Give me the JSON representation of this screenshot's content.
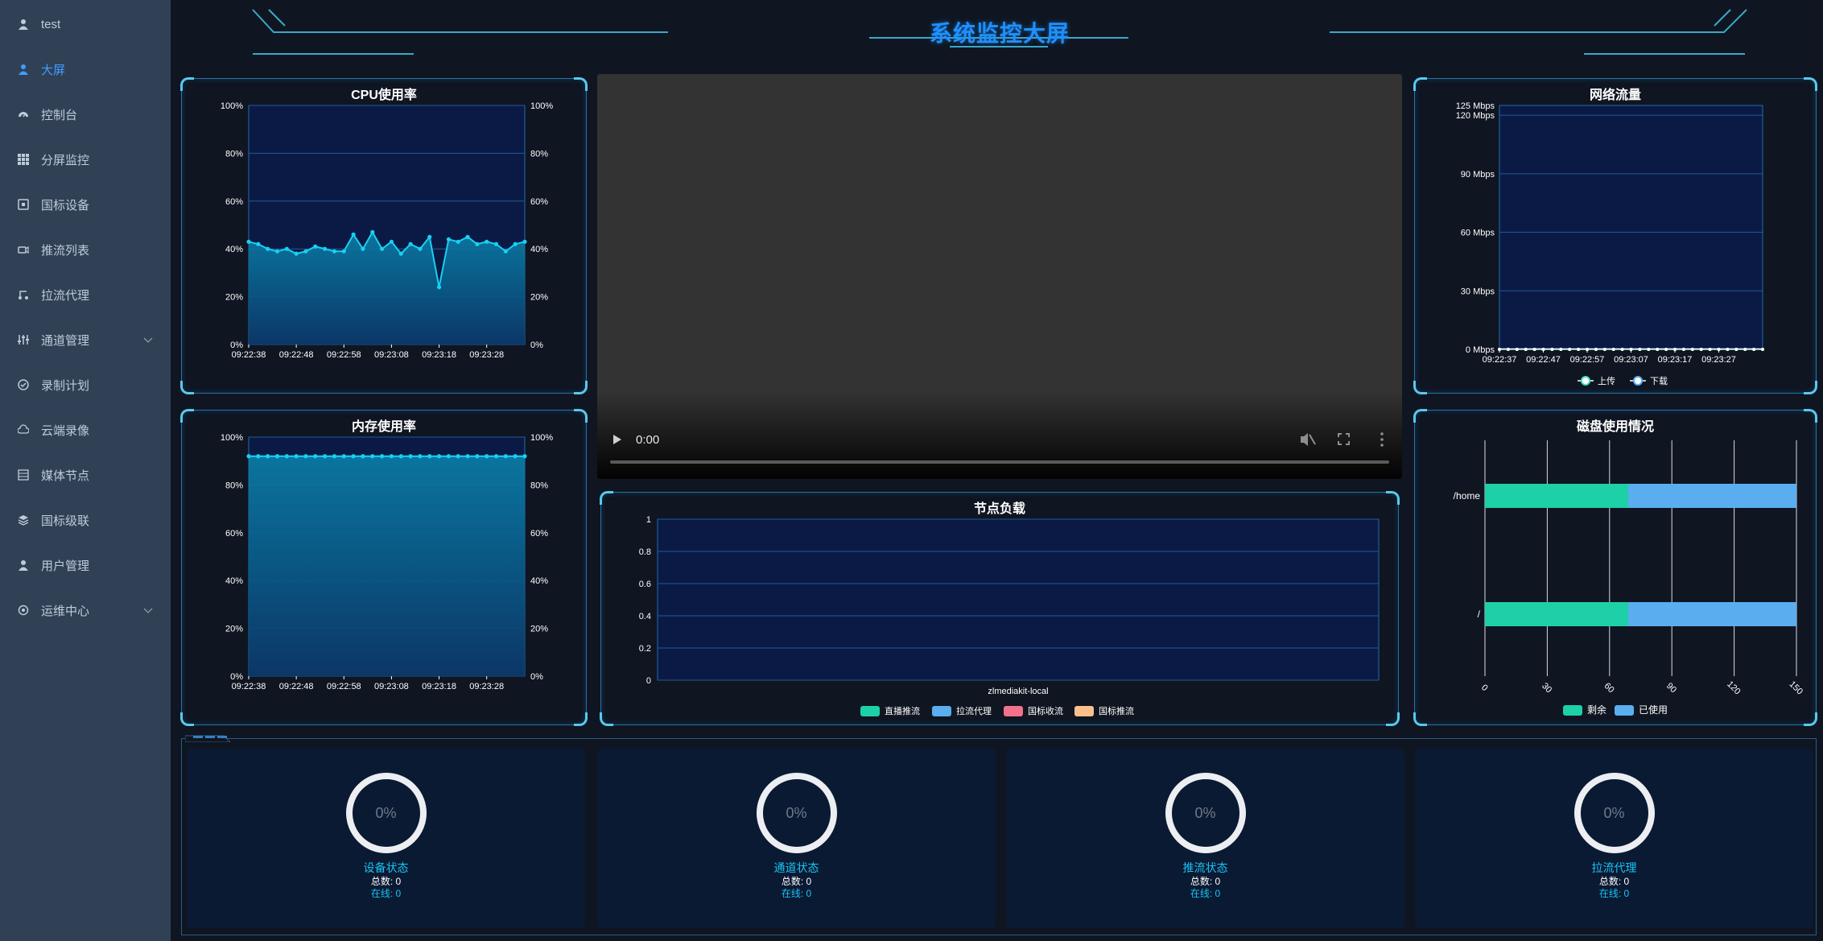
{
  "sidebar": {
    "items": [
      {
        "label": "test",
        "icon": "user-icon",
        "active": false
      },
      {
        "label": "大屏",
        "icon": "user-icon",
        "active": true
      },
      {
        "label": "控制台",
        "icon": "dashboard-icon",
        "active": false
      },
      {
        "label": "分屏监控",
        "icon": "grid-icon",
        "active": false
      },
      {
        "label": "国标设备",
        "icon": "device-icon",
        "active": false
      },
      {
        "label": "推流列表",
        "icon": "camera-icon",
        "active": false
      },
      {
        "label": "拉流代理",
        "icon": "proxy-icon",
        "active": false
      },
      {
        "label": "通道管理",
        "icon": "sliders-icon",
        "active": false,
        "expandable": true
      },
      {
        "label": "录制计划",
        "icon": "record-icon",
        "active": false
      },
      {
        "label": "云端录像",
        "icon": "cloud-icon",
        "active": false
      },
      {
        "label": "媒体节点",
        "icon": "server-icon",
        "active": false
      },
      {
        "label": "国标级联",
        "icon": "layers-icon",
        "active": false
      },
      {
        "label": "用户管理",
        "icon": "user-icon",
        "active": false
      },
      {
        "label": "运维中心",
        "icon": "settings-icon",
        "active": false,
        "expandable": true
      }
    ]
  },
  "header": {
    "title": "系统监控大屏"
  },
  "panels": {
    "cpu": {
      "title": "CPU使用率"
    },
    "memory": {
      "title": "内存使用率"
    },
    "network": {
      "title": "网络流量"
    },
    "disk": {
      "title": "磁盘使用情况"
    },
    "node": {
      "title": "节点负载"
    }
  },
  "video": {
    "time": "0:00",
    "progress": 0
  },
  "colors": {
    "accent": "#1e90ff",
    "cyan": "#16c4f4",
    "sidebar_bg": "#304156",
    "disk_free": "#1dd0a8",
    "disk_used": "#5aaef0"
  },
  "chart_data": [
    {
      "id": "cpu",
      "type": "area",
      "title": "CPU使用率",
      "x": [
        "09:22:38",
        "09:22:40",
        "09:22:42",
        "09:22:44",
        "09:22:46",
        "09:22:48",
        "09:22:50",
        "09:22:52",
        "09:22:54",
        "09:22:56",
        "09:22:58",
        "09:23:00",
        "09:23:02",
        "09:23:04",
        "09:23:06",
        "09:23:08",
        "09:23:10",
        "09:23:12",
        "09:23:14",
        "09:23:16",
        "09:23:18",
        "09:23:20",
        "09:23:22",
        "09:23:24",
        "09:23:26",
        "09:23:28",
        "09:23:30",
        "09:23:32",
        "09:23:34",
        "09:23:36"
      ],
      "xticks": [
        "09:22:38",
        "09:22:48",
        "09:22:58",
        "09:23:08",
        "09:23:18",
        "09:23:28"
      ],
      "values": [
        43,
        42,
        40,
        39,
        40,
        38,
        39,
        41,
        40,
        39,
        39,
        46,
        40,
        47,
        40,
        43,
        38,
        42,
        40,
        45,
        24,
        44,
        43,
        45,
        42,
        43,
        42,
        39,
        42,
        43
      ],
      "yticks": [
        "0%",
        "20%",
        "40%",
        "60%",
        "80%",
        "100%"
      ],
      "ylim": [
        0,
        100
      ],
      "grid": true
    },
    {
      "id": "memory",
      "type": "area",
      "title": "内存使用率",
      "x": [
        "09:22:38",
        "09:22:40",
        "09:22:42",
        "09:22:44",
        "09:22:46",
        "09:22:48",
        "09:22:50",
        "09:22:52",
        "09:22:54",
        "09:22:56",
        "09:22:58",
        "09:23:00",
        "09:23:02",
        "09:23:04",
        "09:23:06",
        "09:23:08",
        "09:23:10",
        "09:23:12",
        "09:23:14",
        "09:23:16",
        "09:23:18",
        "09:23:20",
        "09:23:22",
        "09:23:24",
        "09:23:26",
        "09:23:28",
        "09:23:30",
        "09:23:32",
        "09:23:34",
        "09:23:36"
      ],
      "xticks": [
        "09:22:38",
        "09:22:48",
        "09:22:58",
        "09:23:08",
        "09:23:18",
        "09:23:28"
      ],
      "values": [
        92,
        92,
        92,
        92,
        92,
        92,
        92,
        92,
        92,
        92,
        92,
        92,
        92,
        92,
        92,
        92,
        92,
        92,
        92,
        92,
        92,
        92,
        92,
        92,
        92,
        92,
        92,
        92,
        92,
        92
      ],
      "yticks": [
        "0%",
        "20%",
        "40%",
        "60%",
        "80%",
        "100%"
      ],
      "ylim": [
        0,
        100
      ],
      "grid": true
    },
    {
      "id": "network",
      "type": "line",
      "title": "网络流量",
      "xticks": [
        "09:22:37",
        "09:22:47",
        "09:22:57",
        "09:23:07",
        "09:23:17",
        "09:23:27"
      ],
      "yticks": [
        "0 Mbps",
        "30 Mbps",
        "60 Mbps",
        "90 Mbps",
        "120 Mbps",
        "125 Mbps"
      ],
      "ylim": [
        0,
        125
      ],
      "series": [
        {
          "name": "上传",
          "values": [
            0,
            0,
            0,
            0,
            0,
            0,
            0,
            0,
            0,
            0,
            0,
            0,
            0,
            0,
            0,
            0,
            0,
            0,
            0,
            0,
            0,
            0,
            0,
            0,
            0,
            0,
            0,
            0,
            0,
            0,
            0
          ]
        },
        {
          "name": "下载",
          "values": [
            0,
            0,
            0,
            0,
            0,
            0,
            0,
            0,
            0,
            0,
            0,
            0,
            0,
            0,
            0,
            0,
            0,
            0,
            0,
            0,
            0,
            0,
            0,
            0,
            0,
            0,
            0,
            0,
            0,
            0,
            0
          ]
        }
      ],
      "legend": "bottom"
    },
    {
      "id": "node",
      "type": "bar",
      "title": "节点负载",
      "categories": [
        "zlmediakit-local"
      ],
      "yticks": [
        "0",
        "0.2",
        "0.4",
        "0.6",
        "0.8",
        "1"
      ],
      "ylim": [
        0,
        1
      ],
      "series": [
        {
          "name": "直播推流",
          "color": "#1dd0a8",
          "values": [
            0
          ]
        },
        {
          "name": "拉流代理",
          "color": "#5aaef0",
          "values": [
            0
          ]
        },
        {
          "name": "国标收流",
          "color": "#f4718b",
          "values": [
            0
          ]
        },
        {
          "name": "国标推流",
          "color": "#f9c08c",
          "values": [
            0
          ]
        }
      ],
      "legend": "bottom"
    },
    {
      "id": "disk",
      "type": "bar",
      "orientation": "horizontal",
      "stacked": true,
      "title": "磁盘使用情况",
      "categories": [
        "/home",
        "/"
      ],
      "xticks": [
        "0",
        "30",
        "60",
        "90",
        "120",
        "150"
      ],
      "xlim": [
        0,
        150
      ],
      "series": [
        {
          "name": "剩余",
          "color": "#1dd0a8",
          "values": [
            69,
            69
          ]
        },
        {
          "name": "已使用",
          "color": "#5aaef0",
          "values": [
            81,
            81
          ]
        }
      ],
      "legend": "bottom"
    }
  ],
  "stats": [
    {
      "name": "设备状态",
      "percent": "0%",
      "total_label": "总数: 0",
      "online_label": "在线: 0"
    },
    {
      "name": "通道状态",
      "percent": "0%",
      "total_label": "总数: 0",
      "online_label": "在线: 0"
    },
    {
      "name": "推流状态",
      "percent": "0%",
      "total_label": "总数: 0",
      "online_label": "在线: 0"
    },
    {
      "name": "拉流代理",
      "percent": "0%",
      "total_label": "总数: 0",
      "online_label": "在线: 0"
    }
  ]
}
